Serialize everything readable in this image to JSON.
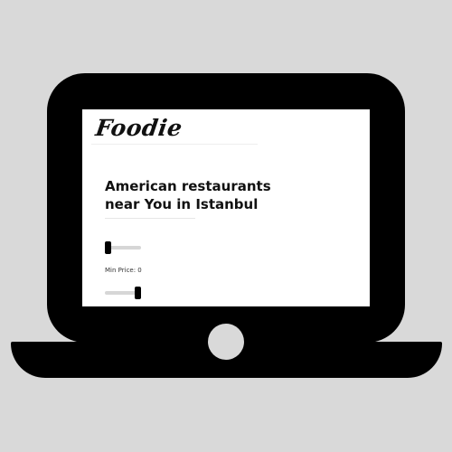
{
  "app": {
    "logo_text": "Foodie"
  },
  "main": {
    "title_line1": "American restaurants",
    "title_line2": "near You in Istanbul"
  },
  "filters": {
    "price_slider_top": {
      "value_fraction": 0.0
    },
    "min_price_label": "Min Price: 0",
    "price_slider_bottom": {
      "value_fraction": 1.0
    }
  },
  "colors": {
    "background": "#d9d9d9",
    "laptop": "#000000",
    "screen": "#ffffff",
    "slider_track": "#d6d6d6",
    "slider_thumb": "#000000"
  }
}
